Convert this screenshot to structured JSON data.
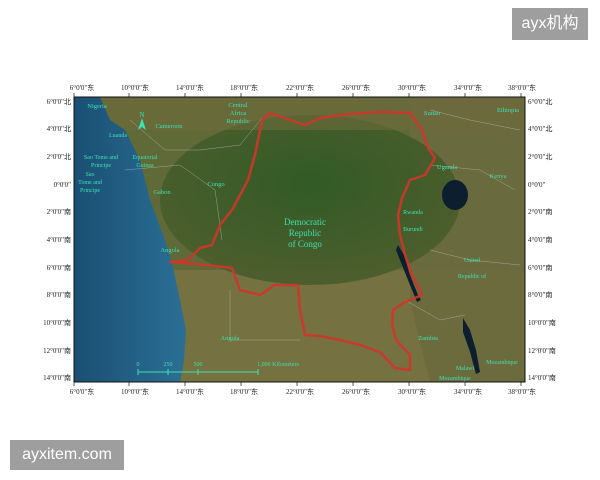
{
  "watermarks": {
    "top": "ayx机构",
    "bottom": "ayxitem.com"
  },
  "map": {
    "lon_ticks": [
      "6°0'0\"东",
      "10°0'0\"东",
      "14°0'0\"东",
      "18°0'0\"东",
      "22°0'0\"东",
      "26°0'0\"东",
      "30°0'0\"东",
      "34°0'0\"东",
      "38°0'0\"东"
    ],
    "lat_ticks_left": [
      "6°0'0\"北",
      "4°0'0\"北",
      "2°0'0\"北",
      "0°0'0\"",
      "2°0'0\"南",
      "4°0'0\"南",
      "6°0'0\"南",
      "8°0'0\"南",
      "10°0'0\"南",
      "12°0'0\"南",
      "14°0'0\"南"
    ],
    "lat_ticks_right": [
      "6°0'0\"北",
      "4°0'0\"北",
      "2°0'0\"北",
      "0°0'0\"",
      "2°0'0\"南",
      "4°0'0\"南",
      "6°0'0\"南",
      "8°0'0\"南",
      "10°0'0\"南",
      "12°0'0\"南",
      "14°0'0\"南"
    ],
    "countries": {
      "nigeria": "Nigeria",
      "cameroon": "Cameroon",
      "car": [
        "Central",
        "Africa",
        "Republic"
      ],
      "sudan": "Sudan",
      "ethiopia": "Ethiopia",
      "sao_tome": [
        "Sao Tome and",
        "Principe"
      ],
      "sao_tome2": [
        "Sao",
        "Tome and",
        "Principe"
      ],
      "eq_guinea": [
        "Equatorial",
        "Guinea"
      ],
      "gabon": "Gabon",
      "congo": "Congo",
      "uganda": "Uganda",
      "kenya": "Kenya",
      "rwanda": "Rwanda",
      "burundi": "Burundi",
      "drc": [
        "Democratic",
        "Republic",
        "of Congo"
      ],
      "tanzania": [
        "United",
        "Republic of"
      ],
      "angola1": "Angola",
      "angola2": "Angola",
      "zambia": "Zambia",
      "mozambique1": "Mozambique",
      "malawi": "Malawi",
      "mozambique2": "Mozambique",
      "luanda": "Luanda"
    },
    "scale": {
      "zero": "0",
      "a": "250",
      "b": "500",
      "end": "1,000 Kilometers"
    },
    "north": "N",
    "colors": {
      "ocean": "#1e5a80",
      "land": "#4e5f2e",
      "border": "#d1352a",
      "label": "#3fe0b0"
    }
  }
}
